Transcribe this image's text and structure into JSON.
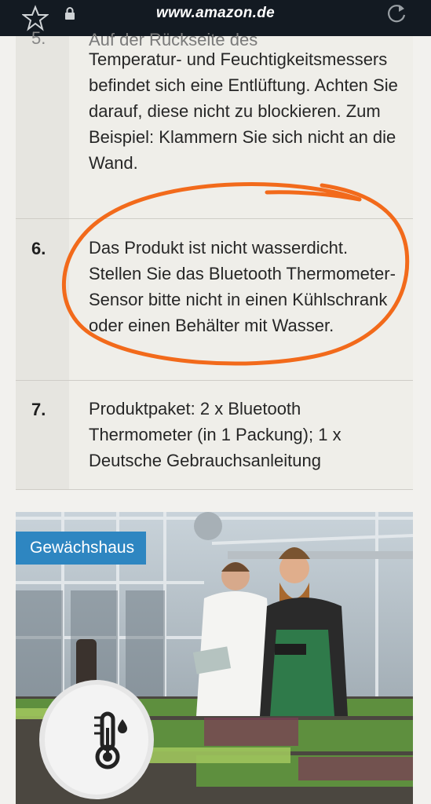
{
  "browser": {
    "url": "www.amazon.de",
    "icons": [
      "star-icon",
      "lock-icon",
      "reload-icon"
    ]
  },
  "list": {
    "partial_top": "Auf der Rückseite des",
    "items": [
      {
        "number": "5.",
        "text": "Temperatur- und Feuchtigkeitsmessers befindet sich eine Entlüftung. Achten Sie darauf, diese nicht zu blockieren. Zum Beispiel: Klammern Sie sich nicht an die Wand."
      },
      {
        "number": "6.",
        "text": "Das Produkt ist nicht wasserdicht. Stellen Sie das Bluetooth Thermometer-Sensor bitte nicht in einen Kühlschrank oder einen Behälter mit Wasser."
      },
      {
        "number": "7.",
        "text": "Produktpaket: 2 x Bluetooth Thermometer (in 1 Packung); 1 x Deutsche Gebrauchsanleitung"
      }
    ]
  },
  "image": {
    "badge": "Gewächshaus",
    "device_icon": "thermometer-humidity-icon"
  },
  "colors": {
    "topbar": "#131a22",
    "annotation": "#f26a1b",
    "badge": "#2e86c1"
  }
}
